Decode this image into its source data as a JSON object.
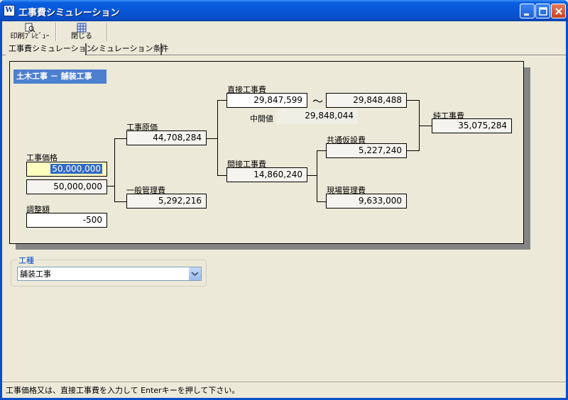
{
  "window": {
    "title": "工事費シミュレーション",
    "app_icon_glyph": "W"
  },
  "toolbar": {
    "preview_label": "印刷ﾌﾟﾚﾋﾞｭｰ",
    "close_label": "閉じる"
  },
  "tabs": [
    {
      "label": "工事費シミュレーション",
      "active": true
    },
    {
      "label": "シミュレーション条件",
      "active": false
    }
  ],
  "panel": {
    "section_title": "土木工事 － 舗装工事",
    "construction_price": {
      "label": "工事価格",
      "input_value": "50,000,000",
      "value2": "50,000,000"
    },
    "adjustment": {
      "label": "調整額",
      "value": "-500"
    },
    "cost_price": {
      "label": "工事原価",
      "value": "44,708,284"
    },
    "general_admin": {
      "label": "一般管理費",
      "value": "5,292,216"
    },
    "direct_cost": {
      "label": "直接工事費",
      "value_from": "29,847,599",
      "tilde": "～",
      "value_to": "29,848,488"
    },
    "midpoint": {
      "label": "中間値",
      "value": "29,848,044"
    },
    "indirect_cost": {
      "label": "間接工事費",
      "value": "14,860,240"
    },
    "common_temp": {
      "label": "共通仮設費",
      "value": "5,227,240"
    },
    "site_admin": {
      "label": "現場管理費",
      "value": "9,633,000"
    },
    "net_cost": {
      "label": "純工事費",
      "value": "35,075,284"
    }
  },
  "work_type": {
    "group_label": "工種",
    "selected": "舗装工事"
  },
  "status": {
    "text": "工事価格又は、直接工事費を入力して Enterキーを押して下さい。"
  },
  "colors": {
    "title_bar": "#0a5fe0",
    "section_header": "#4d7fcf",
    "input_highlight": "#ffffc0",
    "selection": "#316ac5"
  }
}
